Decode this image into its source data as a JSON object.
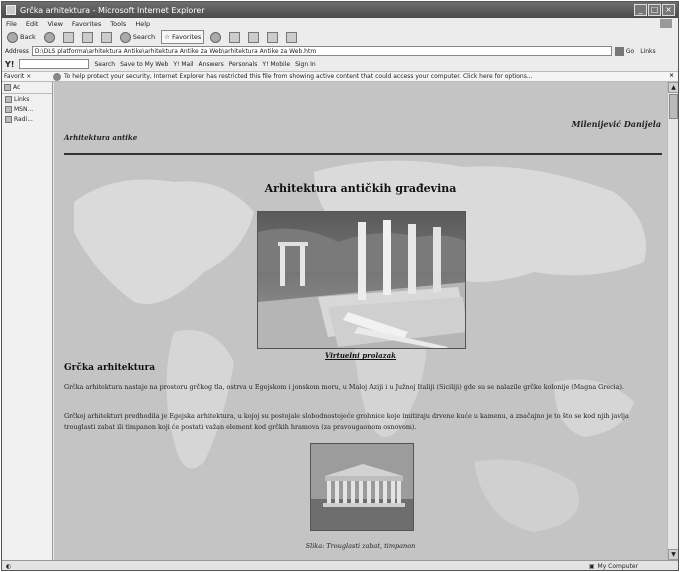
{
  "window": {
    "title": "Grčka arhitektura - Microsoft Internet Explorer"
  },
  "menu": [
    "File",
    "Edit",
    "View",
    "Favorites",
    "Tools",
    "Help"
  ],
  "toolbar": {
    "back": "Back",
    "search": "Search",
    "favorites": "Favorites"
  },
  "address": {
    "label": "Address",
    "value": "D:\\DLS platforma\\arhitektura Antike\\arhitektura Antike za Web\\arhitektura Antike za Web.htm",
    "go": "Go",
    "links": "Links"
  },
  "yahoo": {
    "search": "Search",
    "save": "Save to My Web",
    "mail": "Y! Mail",
    "answers": "Answers",
    "personals": "Personals",
    "mobile": "Y! Mobile",
    "signin": "Sign In"
  },
  "infobar": {
    "favorites": "Favorit ×",
    "message": "To help protect your security, Internet Explorer has restricted this file from showing active content that could access your computer. Click here for options..."
  },
  "sidebar": {
    "header": "Ac",
    "items": [
      "Links",
      "MSN...",
      "Radi..."
    ]
  },
  "page": {
    "author": "Milenijević Danijela",
    "site_name": "Arhitektura antike",
    "title": "Arhitektura antičkih građevina",
    "hero_link": "Virtuelni prolazak",
    "heading": "Grčka arhitektura",
    "para1": "Grčka arhitektura nastaje na prostoru grčkog tla, ostrva u Egejskom i jonskom moru, u Maloj Aziji i u Južnoj Italiji (Siciliji) gde su se nalazile grčke kolonije (Magna Grecia).",
    "para2": "Grčkoj arhitekturi predhodila je Egejska arhitektura, u kojoj su postojale slobodnostojeće grobnice koje imitiraju drvene kuće u kamenu, a značajno je to što se kod njih javlja trouglasti zabat ili timpanon koji će postati važan element kod grčkih hramova (za pravougaonom osnovom).",
    "caption": "Slika: Trouglasti zabat, timpanon"
  },
  "status": {
    "zone": "My Computer"
  }
}
